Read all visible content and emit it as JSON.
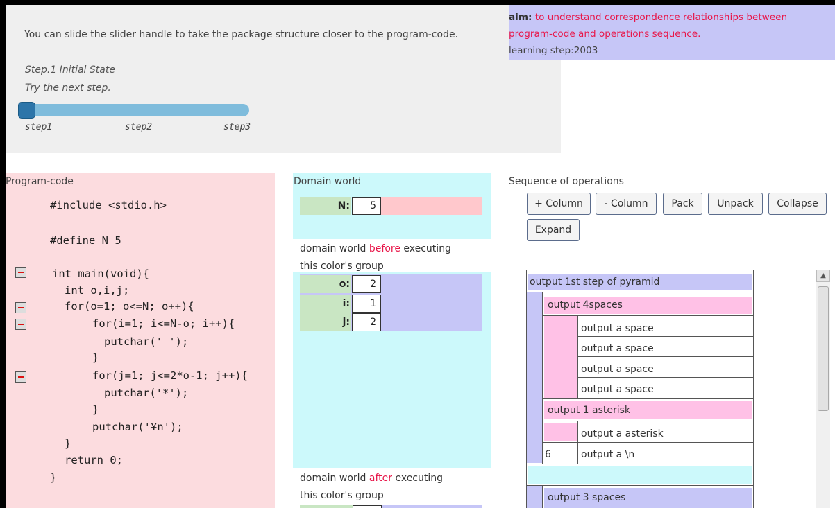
{
  "header": {
    "instruction": "You can slide the slider handle to take the package structure closer to the program-code.",
    "step_title": "Step.1   Initial State",
    "step_hint": "Try the next step.",
    "slider": {
      "steps": [
        "step1",
        "step2",
        "step3"
      ],
      "current_step": 1
    }
  },
  "aim": {
    "label": "aim:",
    "text_line1": " to understand correspondence relationships between",
    "text_line2": "program-code and operations sequence.",
    "learning_step": "learning step:2003"
  },
  "program": {
    "title": "Program-code",
    "lines": [
      "#include <stdio.h>",
      "#define N 5",
      "int main(void){",
      "int o,i,j;",
      "for(o=1; o<=N; o++){",
      "for(i=1; i<=N-o; i++){",
      "putchar(' ');",
      "}",
      "for(j=1; j<=2*o-1; j++){",
      "putchar('*');",
      "}",
      "putchar('¥n');",
      "}",
      "return 0;",
      "}"
    ]
  },
  "domain": {
    "title": "Domain world",
    "constant": {
      "name": "N:",
      "value": "5"
    },
    "before_note": {
      "pre": "domain world ",
      "em": "before",
      "post": " executing",
      "line2": "this color's group"
    },
    "variables": [
      {
        "name": "o:",
        "value": "2"
      },
      {
        "name": "i:",
        "value": "1"
      },
      {
        "name": "j:",
        "value": "2"
      }
    ],
    "after_note": {
      "pre": "domain world ",
      "em": "after",
      "post": " executing",
      "line2": "this color's group"
    }
  },
  "operations": {
    "title": "Sequence of operations",
    "buttons": [
      "+ Column",
      "- Column",
      "Pack",
      "Unpack",
      "Collapse",
      "Expand"
    ],
    "tree": {
      "n1": "output 1st step of pyramid",
      "n2": "output 4spaces",
      "spaces": [
        "output a space",
        "output a space",
        "output a space",
        "output a space"
      ],
      "n3": "output 1 asterisk",
      "asterisk": "output a asterisk",
      "row_num": "6",
      "newline": "output a \\n",
      "n4": "output 3 spaces"
    }
  },
  "colors": {
    "header_bg": "#efefef",
    "aim_bg": "#c6c6f7",
    "code_bg": "#fcdcdf",
    "domain_bg": "#ccf9fb",
    "violet": "#c6c6f7",
    "pink": "#ffc1e6",
    "magenta_light": "#ffaadb",
    "cyan": "#ccf9fb",
    "accent_red": "#e8174a"
  }
}
